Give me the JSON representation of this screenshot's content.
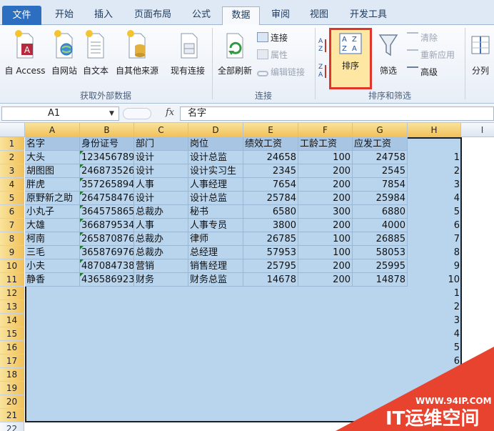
{
  "menu": {
    "tabs": [
      "文件",
      "开始",
      "插入",
      "页面布局",
      "公式",
      "数据",
      "审阅",
      "视图",
      "开发工具"
    ],
    "active": "数据"
  },
  "ribbon": {
    "get_external": {
      "label": "获取外部数据",
      "buttons": [
        "自 Access",
        "自网站",
        "自文本",
        "自其他来源",
        "现有连接"
      ]
    },
    "connections": {
      "label": "连接",
      "refresh_all": "全部刷新",
      "items": [
        "连接",
        "属性",
        "编辑链接"
      ]
    },
    "sort_filter": {
      "label": "排序和筛选",
      "sort": "排序",
      "filter": "筛选",
      "items": [
        "清除",
        "重新应用",
        "高级"
      ]
    },
    "split": "分列",
    "colors": {
      "highlight_border": "#e0352b",
      "sort_bg": "#fde7a3"
    }
  },
  "formula_bar": {
    "name_box": "A1",
    "fx": "fx",
    "content": "名字"
  },
  "grid": {
    "columns": [
      "A",
      "B",
      "C",
      "D",
      "E",
      "F",
      "G",
      "H",
      "I"
    ],
    "row_numbers": [
      "1",
      "2",
      "3",
      "4",
      "5",
      "6",
      "7",
      "8",
      "9",
      "10",
      "11",
      "12",
      "13",
      "14",
      "15",
      "16",
      "17",
      "18",
      "19",
      "20",
      "21",
      "22"
    ],
    "headers": [
      "名字",
      "身份证号",
      "部门",
      "岗位",
      "绩效工资",
      "工龄工资",
      "应发工资"
    ],
    "rows": [
      [
        "大头",
        "123456789",
        "设计",
        "设计总监",
        "24658",
        "100",
        "24758"
      ],
      [
        "胡图图",
        "246873526",
        "设计",
        "设计实习生",
        "2345",
        "200",
        "2545"
      ],
      [
        "胖虎",
        "357265894",
        "人事",
        "人事经理",
        "7654",
        "200",
        "7854"
      ],
      [
        "原野新之助",
        "264758476",
        "设计",
        "设计总监",
        "25784",
        "200",
        "25984"
      ],
      [
        "小丸子",
        "364575865",
        "总裁办",
        "秘书",
        "6580",
        "300",
        "6880"
      ],
      [
        "大雄",
        "366879534",
        "人事",
        "人事专员",
        "3800",
        "200",
        "4000"
      ],
      [
        "柯南",
        "265870876",
        "总裁办",
        "律师",
        "26785",
        "100",
        "26885"
      ],
      [
        "三毛",
        "365876976",
        "总裁办",
        "总经理",
        "57953",
        "100",
        "58053"
      ],
      [
        "小夫",
        "487084738",
        "营销",
        "销售经理",
        "25795",
        "200",
        "25995"
      ],
      [
        "静香",
        "436586923",
        "财务",
        "财务总监",
        "14678",
        "200",
        "14878"
      ]
    ],
    "h_values": [
      "1",
      "2",
      "3",
      "4",
      "5",
      "6",
      "7",
      "8",
      "9",
      "10",
      "1",
      "2",
      "3",
      "4",
      "5",
      "6"
    ],
    "colors": {
      "selection": "#b9d5ee",
      "header_fill": "#a8c6e4",
      "selected_header": "#f1c15b"
    }
  },
  "watermark": {
    "url": "WWW.94IP.COM",
    "brand": "IT运维空间"
  }
}
